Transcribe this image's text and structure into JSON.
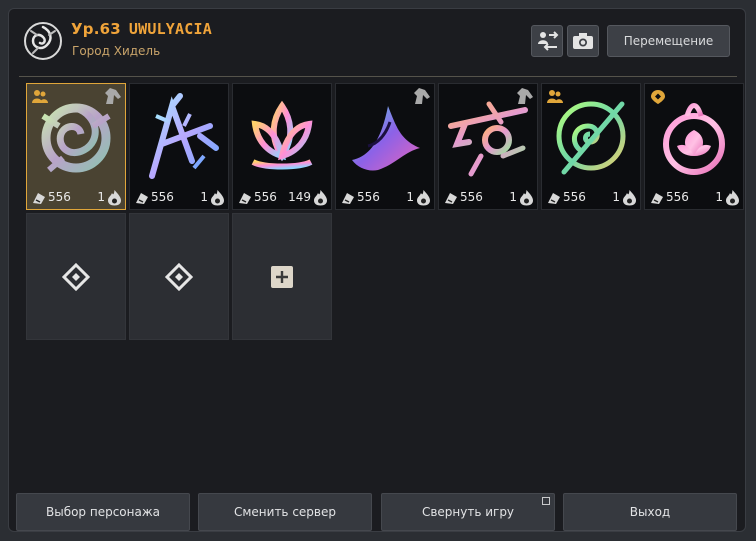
{
  "header": {
    "level": "Ур.63",
    "character_name": "UWULYACIA",
    "location": "Город Хидель",
    "move_button": "Перемещение",
    "icons": [
      "emblem-icon",
      "swap-characters-icon",
      "camera-icon"
    ]
  },
  "slots": [
    {
      "level": "556",
      "count": "1",
      "badge": "party-icon",
      "badge2": "horse-icon",
      "selected": true
    },
    {
      "level": "556",
      "count": "1"
    },
    {
      "level": "556",
      "count": "149"
    },
    {
      "level": "556",
      "count": "1",
      "badge2": "horse-icon"
    },
    {
      "level": "556",
      "count": "1",
      "badge2": "horse-icon"
    },
    {
      "level": "556",
      "count": "1",
      "badge": "party-icon"
    },
    {
      "level": "556",
      "count": "1",
      "badge": "location-pin-icon"
    }
  ],
  "empty_slots": [
    "create-slot-icon",
    "create-slot-icon",
    "add-slot-icon"
  ],
  "footer": {
    "select_character": "Выбор персонажа",
    "change_server": "Сменить сервер",
    "minimize_game": "Свернуть игру",
    "exit": "Выход"
  },
  "colors": {
    "accent": "#f0a43a",
    "window_bg": "#1b1c20",
    "button_bg": "#36393f"
  }
}
